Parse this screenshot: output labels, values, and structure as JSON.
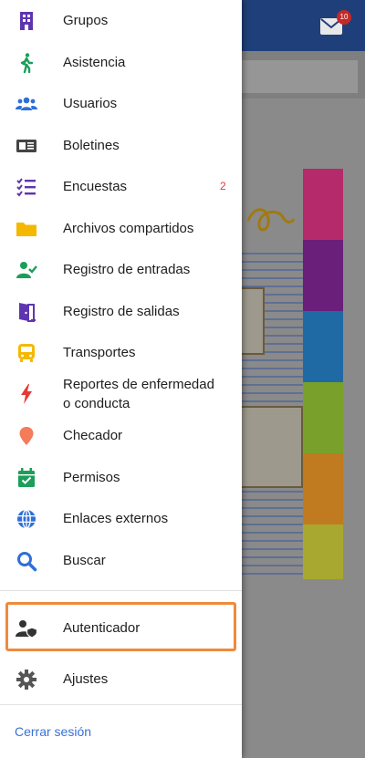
{
  "background": {
    "mail_badge": "10",
    "colors": {
      "topbar": "#1f3f7a",
      "strips": [
        "#b52a6a",
        "#6a1f7a",
        "#1f6aa5",
        "#79a02a",
        "#c07a20",
        "#a8a830"
      ]
    }
  },
  "menu": {
    "items": [
      {
        "label": "Grupos",
        "icon": "building-icon",
        "color": "#5e35b1"
      },
      {
        "label": "Asistencia",
        "icon": "walking-person-icon",
        "color": "#1b9e5a"
      },
      {
        "label": "Usuarios",
        "icon": "people-group-icon",
        "color": "#2f6fd6"
      },
      {
        "label": "Boletines",
        "icon": "newspaper-icon",
        "color": "#444444"
      },
      {
        "label": "Encuestas",
        "icon": "checklist-icon",
        "color": "#5e35b1",
        "badge": "2"
      },
      {
        "label": "Archivos compartidos",
        "icon": "folder-icon",
        "color": "#f5b800"
      },
      {
        "label": "Registro de entradas",
        "icon": "user-check-icon",
        "color": "#1b9e5a"
      },
      {
        "label": "Registro de salidas",
        "icon": "door-exit-icon",
        "color": "#5e35b1"
      },
      {
        "label": "Transportes",
        "icon": "bus-icon",
        "color": "#f5b800"
      },
      {
        "label": "Reportes de enfermedad",
        "label2": "o conducta",
        "icon": "lightning-icon",
        "color": "#e53935"
      },
      {
        "label": "Checador",
        "icon": "map-pin-icon",
        "color": "#f47c5a"
      },
      {
        "label": "Permisos",
        "icon": "calendar-check-icon",
        "color": "#1b9e5a"
      },
      {
        "label": "Enlaces externos",
        "icon": "globe-icon",
        "color": "#2f6fd6"
      },
      {
        "label": "Buscar",
        "icon": "search-icon",
        "color": "#2f6fd6"
      },
      {
        "label": "Autenticador",
        "icon": "user-shield-icon",
        "color": "#333333"
      },
      {
        "label": "Ajustes",
        "icon": "gear-icon",
        "color": "#555555"
      }
    ],
    "logout_label": "Cerrar sesión",
    "highlight_color": "#f08a3c"
  }
}
